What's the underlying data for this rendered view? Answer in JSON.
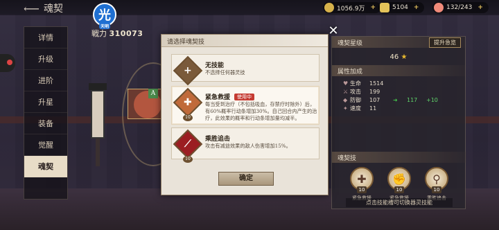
{
  "header": {
    "title": "魂契",
    "resources": [
      {
        "icon": "coin-icon",
        "value": "1056.9万"
      },
      {
        "icon": "gold-ingot-icon",
        "value": "5104"
      },
      {
        "icon": "peach-icon",
        "value": "132/243"
      }
    ]
  },
  "player": {
    "avatar_char": "光",
    "avatar_sub": "天明",
    "power_label": "戦力",
    "power_value": "310073"
  },
  "nav": {
    "items": [
      "详情",
      "升级",
      "进阶",
      "升星",
      "装备",
      "觉醒",
      "魂契"
    ],
    "active": "魂契"
  },
  "character": {
    "badge": "A"
  },
  "right_panel": {
    "star_title": "魂契星级",
    "upgrade_button": "提升急览",
    "star_level": "46",
    "attr_title": "属性加成",
    "attributes": [
      {
        "name": "生命",
        "value": "1514",
        "arrow": "",
        "gain": ""
      },
      {
        "name": "攻击",
        "value": "199",
        "arrow": "",
        "gain": ""
      },
      {
        "name": "防御",
        "value": "107",
        "arrow": "117",
        "gain": "+10"
      },
      {
        "name": "速度",
        "value": "11",
        "arrow": "",
        "gain": ""
      }
    ],
    "skills_title": "魂契技",
    "skills": [
      {
        "name": "紧急救援",
        "level": "10"
      },
      {
        "name": "紧急救援",
        "level": "10"
      },
      {
        "name": "乘胜追击",
        "level": "10"
      }
    ],
    "footer": "点击技能槽可切换器灵技能"
  },
  "dialog": {
    "title": "请选择魂契技",
    "options": [
      {
        "name": "无技能",
        "tag": "",
        "desc": "不选择任何器灵技",
        "icon": "plus-icon",
        "level": ""
      },
      {
        "name": "紧急救援",
        "tag": "使用中",
        "desc": "每当受到治疗（不包括吸血，存禁疗时除外）后，有60%概率行动条增加30%。自己回合内产生的治疗，此效果的概率和行动条增加量均减半。",
        "icon": "heal-cross-icon",
        "level": "10"
      },
      {
        "name": "乘胜追击",
        "tag": "",
        "desc": "攻击有减益效果的敌人伤害增加15%。",
        "icon": "slash-icon",
        "level": "10"
      }
    ],
    "confirm_label": "确定"
  }
}
